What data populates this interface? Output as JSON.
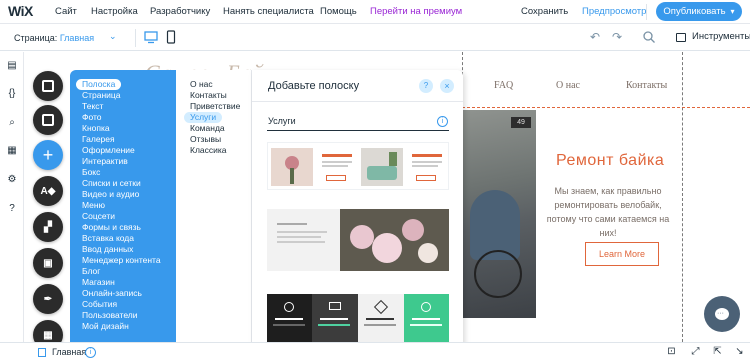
{
  "topbar": {
    "logo": "WiX",
    "menu": [
      "Сайт",
      "Настройка",
      "Разработчику",
      "Нанять специалиста",
      "Помощь"
    ],
    "premium": "Перейти на премиум",
    "save": "Сохранить",
    "preview": "Предпросмотр",
    "publish": "Опубликовать"
  },
  "secbar": {
    "page_label": "Страница:",
    "page_value": "Главная",
    "tools": "Инструменты"
  },
  "site": {
    "logo_partial": "Самогу Байк",
    "nav": [
      "FAQ",
      "О нас",
      "Контакты"
    ],
    "photo_badge": "49",
    "hero_title": "Ремонт байка",
    "hero_text": "Мы знаем, как правильно ремонтировать велобайк, потому что сами катаемся на них!",
    "hero_button": "Learn More"
  },
  "add_panel": {
    "categories": [
      "Полоска",
      "Страница",
      "Текст",
      "Фото",
      "Кнопка",
      "Галерея",
      "Оформление",
      "Интерактив",
      "Бокс",
      "Списки и сетки",
      "Видео и аудио",
      "Меню",
      "Соцсети",
      "Формы и связь",
      "Вставка кода",
      "Ввод данных",
      "Менеджер контента",
      "Блог",
      "Магазин",
      "Онлайн-запись",
      "События",
      "Пользователи",
      "Мой дизайн"
    ],
    "selected_category": "Полоска",
    "subcategories": [
      "О нас",
      "Контакты",
      "Приветствие",
      "Услуги",
      "Команда",
      "Отзывы",
      "Классика"
    ],
    "selected_subcategory": "Услуги",
    "title": "Добавьте полоску",
    "help": "?",
    "close": "×",
    "section": "Услуги",
    "info": "i"
  },
  "bottombar": {
    "page": "Главная",
    "info": "i"
  },
  "colors": {
    "accent": "#3899ec",
    "premium": "#9a27d5",
    "site_accent": "#e0663b"
  }
}
